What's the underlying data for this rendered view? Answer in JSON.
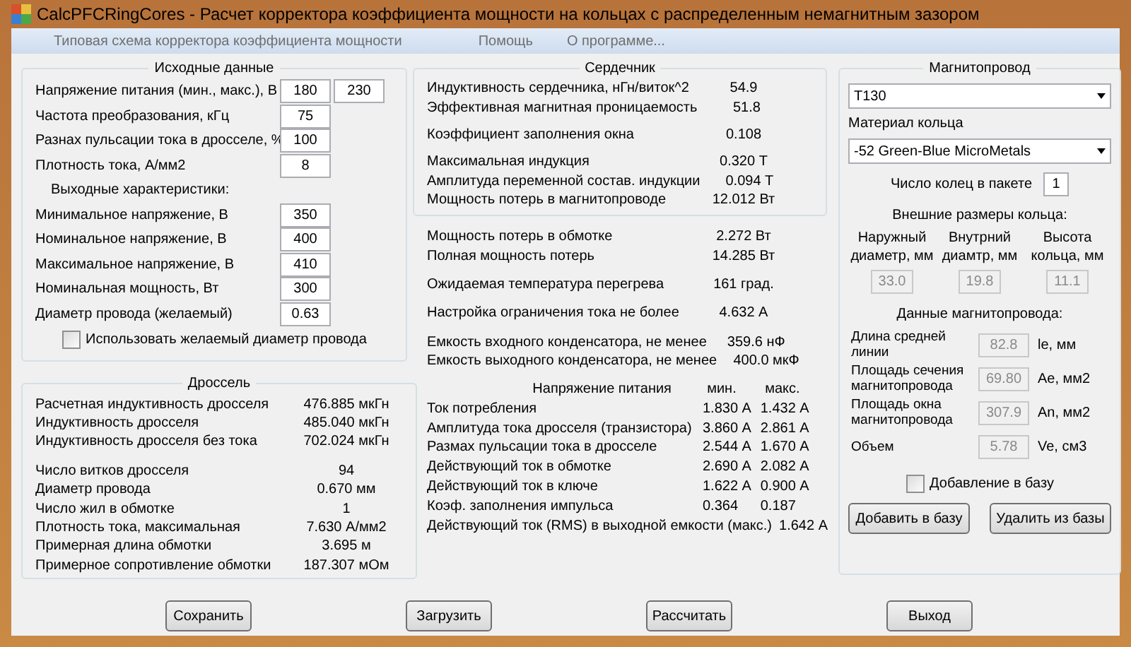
{
  "window": {
    "title": "CalcPFCRingCores - Расчет корректора коэффициента мощности на кольцах с распределенным немагнитным зазором"
  },
  "menu": [
    "Типовая схема корректора коэффициента мощности",
    "Помощь",
    "О программе..."
  ],
  "input": {
    "title": "Исходные данные",
    "rows": [
      {
        "label": "Напряжение питания (мин.,  макс.), В",
        "values": [
          "180",
          "230"
        ]
      },
      {
        "label": "Частота преобразования, кГц",
        "values": [
          "75"
        ]
      },
      {
        "label": "Разнах пульсации тока в дросселе, %",
        "values": [
          "100"
        ]
      },
      {
        "label": "Плотность тока, А/мм2",
        "values": [
          "8"
        ]
      }
    ],
    "output_heading": "Выходные характеристики:",
    "output_rows": [
      {
        "label": "Минимальное напряжение, В",
        "values": [
          "350"
        ]
      },
      {
        "label": "Номинальное напряжение, В",
        "values": [
          "400"
        ]
      },
      {
        "label": "Максимальное напряжение, В",
        "values": [
          "410"
        ]
      },
      {
        "label": "Номинальная мощность, Вт",
        "values": [
          "300"
        ]
      },
      {
        "label": "Диаметр провода (желаемый)",
        "values": [
          "0.63"
        ]
      }
    ],
    "checkbox": {
      "label": "Использовать желаемый диаметр провода",
      "checked": false
    }
  },
  "choke": {
    "title": "Дроссель",
    "groups": [
      [
        {
          "label": "Расчетная индуктивность дросселя",
          "value": "476.885 мкГн"
        },
        {
          "label": "Индуктивность дросселя",
          "value": "485.040 мкГн"
        },
        {
          "label": "Индуктивность дросселя без тока",
          "value": "702.024 мкГн"
        }
      ],
      [
        {
          "label": "Число витков дросселя",
          "value": "94"
        },
        {
          "label": "Диаметр провода",
          "value": "0.670 мм"
        },
        {
          "label": "Число жил в обмотке",
          "value": "1"
        },
        {
          "label": "Плотность тока, максимальная",
          "value": "7.630 А/мм2"
        },
        {
          "label": "Примерная длина обмотки",
          "value": "3.695 м"
        },
        {
          "label": "Примерное сопротивление обмотки",
          "value": "187.307 мОм"
        }
      ]
    ]
  },
  "core": {
    "title": "Сердечник",
    "groups": [
      [
        {
          "label": "Индуктивность сердечника, нГн/виток^2",
          "value": "54.9"
        },
        {
          "label": "Эффективная магнитная проницаемость",
          "value": "51.8"
        }
      ],
      [
        {
          "label": "Коэффициент заполнения окна",
          "value": "0.108"
        }
      ],
      [
        {
          "label": "Максимальная индукция",
          "value": "0.320 Т"
        },
        {
          "label": "Амплитуда переменной состав. индукции",
          "value": "0.094 Т"
        },
        {
          "label": "Мощность потерь в магнитопроводе",
          "value": "12.012 Вт"
        }
      ]
    ]
  },
  "results": {
    "groups": [
      [
        {
          "label": "Мощность потерь в обмотке",
          "value": "2.272 Вт"
        },
        {
          "label": "Полная мощность потерь",
          "value": "14.285 Вт"
        }
      ],
      [
        {
          "label": "Ожидаемая температура перегрева",
          "value": "161 град."
        }
      ],
      [
        {
          "label": "Настройка ограничения тока не более",
          "value": "4.632 А"
        }
      ],
      [
        {
          "label": "Емкость входного конденсатора, не менее",
          "value": "359.6 нФ"
        },
        {
          "label": "Емкость выходного конденсатора, не менее",
          "value": "400.0 мкФ"
        }
      ]
    ]
  },
  "currents": {
    "heading": {
      "label": "Напряжение питания",
      "min": "мин.",
      "max": "макс."
    },
    "rows": [
      {
        "label": "Ток потребления",
        "min": "1.830 А",
        "max": "1.432 А"
      },
      {
        "label": "Амплитуда тока дросселя (транзистора)",
        "min": "3.860 А",
        "max": "2.861 А"
      },
      {
        "label": "Размах пульсации тока в дросселе",
        "min": "2.544 А",
        "max": "1.670 А"
      },
      {
        "label": "Действующий ток в обмотке",
        "min": "2.690 А",
        "max": "2.082 А"
      },
      {
        "label": "Действующий ток в ключе",
        "min": "1.622 А",
        "max": "0.900 А"
      },
      {
        "label": "Коэф. заполнения импульса",
        "min": "0.364",
        "max": "0.187"
      },
      {
        "label": "Действующий ток (RMS) в выходной емкости (макс.)",
        "max": "1.642 А"
      }
    ]
  },
  "magnetic": {
    "title": "Магнитопровод",
    "core_select": "T130",
    "material_label": "Материал кольца",
    "material_select": "-52 Green-Blue MicroMetals",
    "rings": {
      "label": "Число колец в пакете",
      "value": "1"
    },
    "size_heading": "Внешние размеры кольца:",
    "sizes": [
      {
        "label": "Наружный диаметр, мм",
        "value": "33.0",
        "disabled": true
      },
      {
        "label": "Внутрний диамтр, мм",
        "value": "19.8",
        "disabled": true
      },
      {
        "label": "Высота кольца, мм",
        "value": "11.1",
        "disabled": true
      }
    ],
    "data_heading": "Данные магнитопровода:",
    "data": [
      {
        "label": "Длина средней линии",
        "value": "82.8",
        "unit": "le, мм",
        "disabled": true
      },
      {
        "label": "Площадь сечения магнитопровода",
        "value": "69.80",
        "unit": "Ae, мм2",
        "disabled": true
      },
      {
        "label": "Площадь окна магнитопровода",
        "value": "307.9",
        "unit": "An, мм2",
        "disabled": true
      },
      {
        "label": "Объем",
        "value": "5.78",
        "unit": "Ve, см3",
        "disabled": true
      }
    ],
    "checkbox": {
      "label": "Добавление в базу",
      "checked": false
    },
    "buttons": [
      "Добавить в базу",
      "Удалить из базы"
    ]
  },
  "buttons": [
    "Сохранить",
    "Загрузить",
    "Рассчитать",
    "Выход"
  ]
}
